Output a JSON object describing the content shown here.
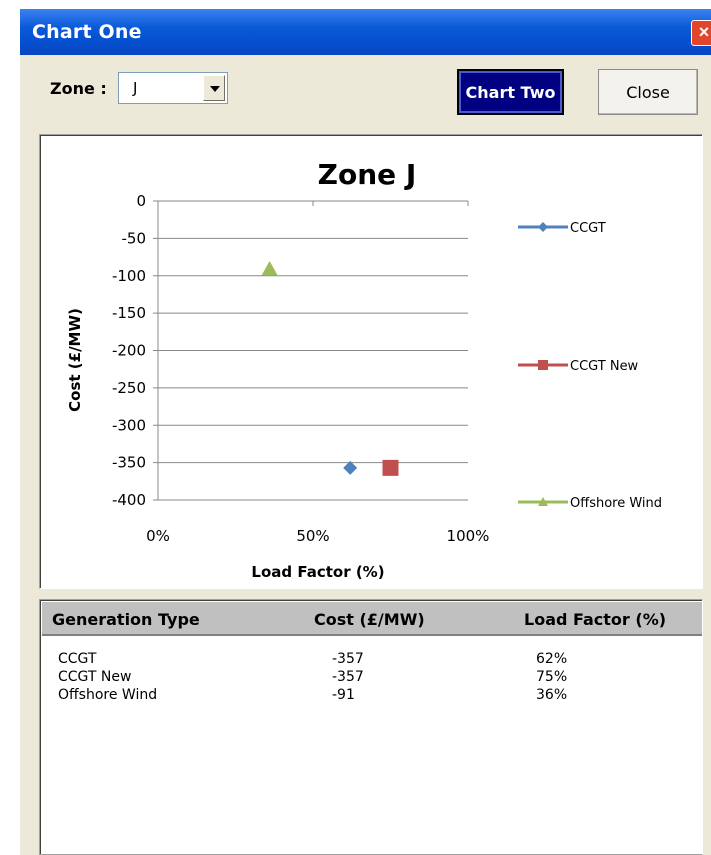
{
  "window": {
    "title": "Chart One",
    "close_glyph": "×"
  },
  "controls": {
    "zone_label": "Zone :",
    "zone_value": "J",
    "chart_two_label": "Chart Two",
    "close_label": "Close"
  },
  "chart_data": {
    "type": "scatter",
    "title": "Zone J",
    "xlabel": "Load Factor (%)",
    "ylabel": "Cost (£/MW)",
    "xlim": [
      0,
      100
    ],
    "ylim": [
      -400,
      0
    ],
    "x_ticks": [
      "0%",
      "50%",
      "100%"
    ],
    "y_ticks": [
      "0",
      "-50",
      "-100",
      "-150",
      "-200",
      "-250",
      "-300",
      "-350",
      "-400"
    ],
    "grid": "horizontal",
    "legend_position": "right",
    "series": [
      {
        "name": "CCGT",
        "x": 62,
        "y": -357,
        "color": "#4f81bd",
        "marker": "diamond"
      },
      {
        "name": "CCGT New",
        "x": 75,
        "y": -357,
        "color": "#c0504d",
        "marker": "square"
      },
      {
        "name": "Offshore Wind",
        "x": 36,
        "y": -91,
        "color": "#9bbb59",
        "marker": "triangle"
      }
    ]
  },
  "table": {
    "headers": [
      "Generation  Type",
      "Cost (£/MW)",
      "Load Factor (%)"
    ],
    "rows": [
      [
        "CCGT",
        "-357",
        "62%"
      ],
      [
        "CCGT New",
        "-357",
        "75%"
      ],
      [
        "Offshore Wind",
        "-91",
        "36%"
      ]
    ]
  }
}
